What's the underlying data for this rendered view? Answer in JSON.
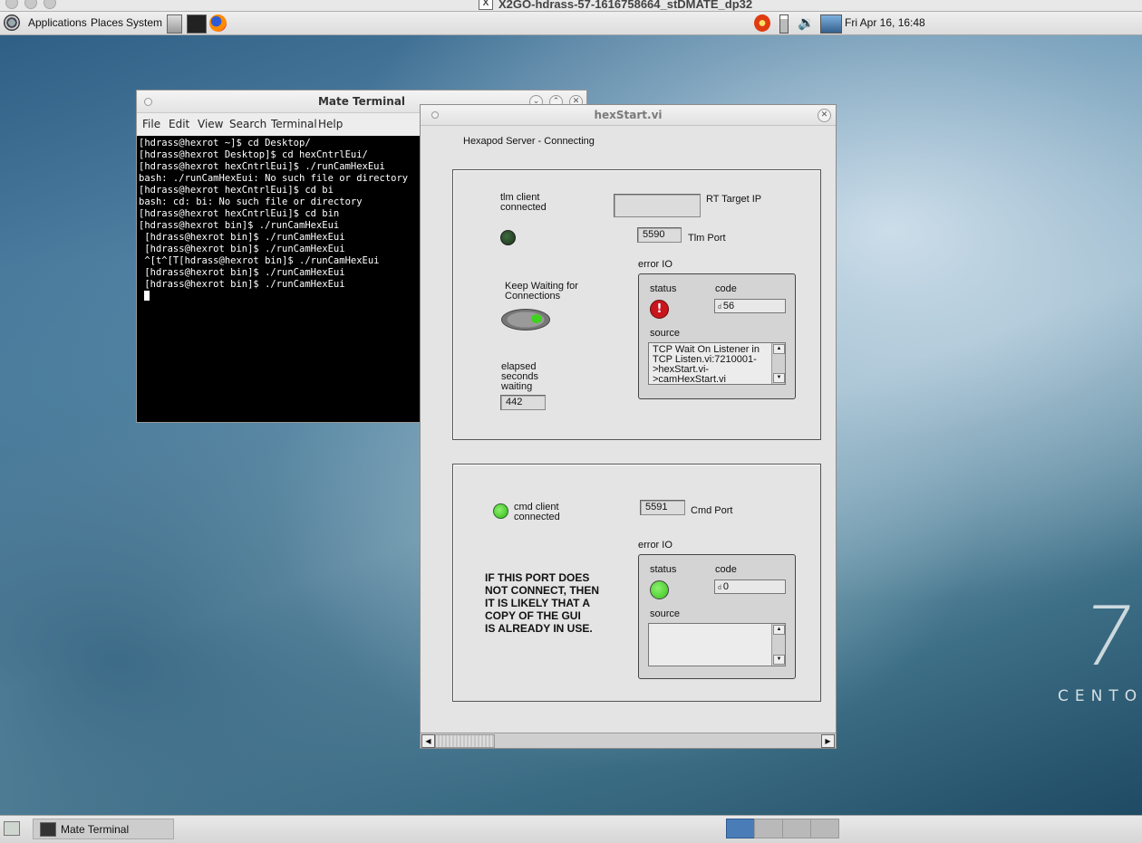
{
  "x2go": {
    "title": "X2GO-hdrass-57-1616758664_stDMATE_dp32"
  },
  "top_panel": {
    "menus": [
      "Applications",
      "Places",
      "System"
    ],
    "launchers": [
      "file-manager-launcher",
      "terminal-launcher",
      "firefox-launcher"
    ],
    "tray_icons": [
      "alert-icon",
      "battery-icon",
      "volume-icon",
      "network-icon"
    ],
    "clock": "Fri Apr 16, 16:48"
  },
  "desktop": {
    "logo_number": "7",
    "logo_text": "CENTO"
  },
  "terminal": {
    "title": "Mate Terminal",
    "menus": [
      "File",
      "Edit",
      "View",
      "Search",
      "Terminal",
      "Help"
    ],
    "lines": [
      "[hdrass@hexrot ~]$ cd Desktop/",
      "[hdrass@hexrot Desktop]$ cd hexCntrlEui/",
      "[hdrass@hexrot hexCntrlEui]$ ./runCamHexEui",
      "bash: ./runCamHexEui: No such file or directory",
      "[hdrass@hexrot hexCntrlEui]$ cd bi",
      "bash: cd: bi: No such file or directory",
      "[hdrass@hexrot hexCntrlEui]$ cd bin",
      "[hdrass@hexrot bin]$ ./runCamHexEui",
      " [hdrass@hexrot bin]$ ./runCamHexEui",
      " [hdrass@hexrot bin]$ ./runCamHexEui",
      " ^[t^[T[hdrass@hexrot bin]$ ./runCamHexEui",
      " [hdrass@hexrot bin]$ ./runCamHexEui",
      " [hdrass@hexrot bin]$ ./runCamHexEui"
    ]
  },
  "hexstart": {
    "title": "hexStart.vi",
    "header": "Hexapod Server  - Connecting",
    "tlm": {
      "client_label_1": "tlm client",
      "client_label_2": "connected",
      "rt_target_ip_label": "RT Target IP",
      "rt_target_ip_value": "",
      "port_value": "5590",
      "port_label": "Tlm Port",
      "keep_waiting_1": "Keep Waiting for",
      "keep_waiting_2": "Connections",
      "elapsed_1": "elapsed",
      "elapsed_2": "seconds",
      "elapsed_3": "waiting",
      "elapsed_value": "442",
      "error_io_label": "error IO",
      "status_label": "status",
      "code_label": "code",
      "code_prefix": "d",
      "code_value": "56",
      "source_label": "source",
      "source_lines": [
        "TCP Wait On Listener in",
        "TCP Listen.vi:7210001-",
        ">hexStart.vi-",
        ">camHexStart.vi"
      ]
    },
    "cmd": {
      "client_label_1": "cmd client",
      "client_label_2": "connected",
      "port_value": "5591",
      "port_label": "Cmd Port",
      "warning_lines": [
        "IF THIS PORT DOES",
        "NOT CONNECT, THEN",
        "IT IS  LIKELY THAT A",
        "COPY OF THE GUI",
        "IS ALREADY IN USE."
      ],
      "error_io_label": "error IO",
      "status_label": "status",
      "code_label": "code",
      "code_prefix": "d",
      "code_value": "0",
      "source_label": "source"
    }
  },
  "bottom_panel": {
    "task_label": "Mate Terminal",
    "workspaces": 4,
    "active_workspace": 1
  },
  "colors": {
    "led_dark": "#1f3d1f",
    "led_green": "#3fd21f",
    "error_red": "#c8161c",
    "terminal_bg": "#000000"
  }
}
